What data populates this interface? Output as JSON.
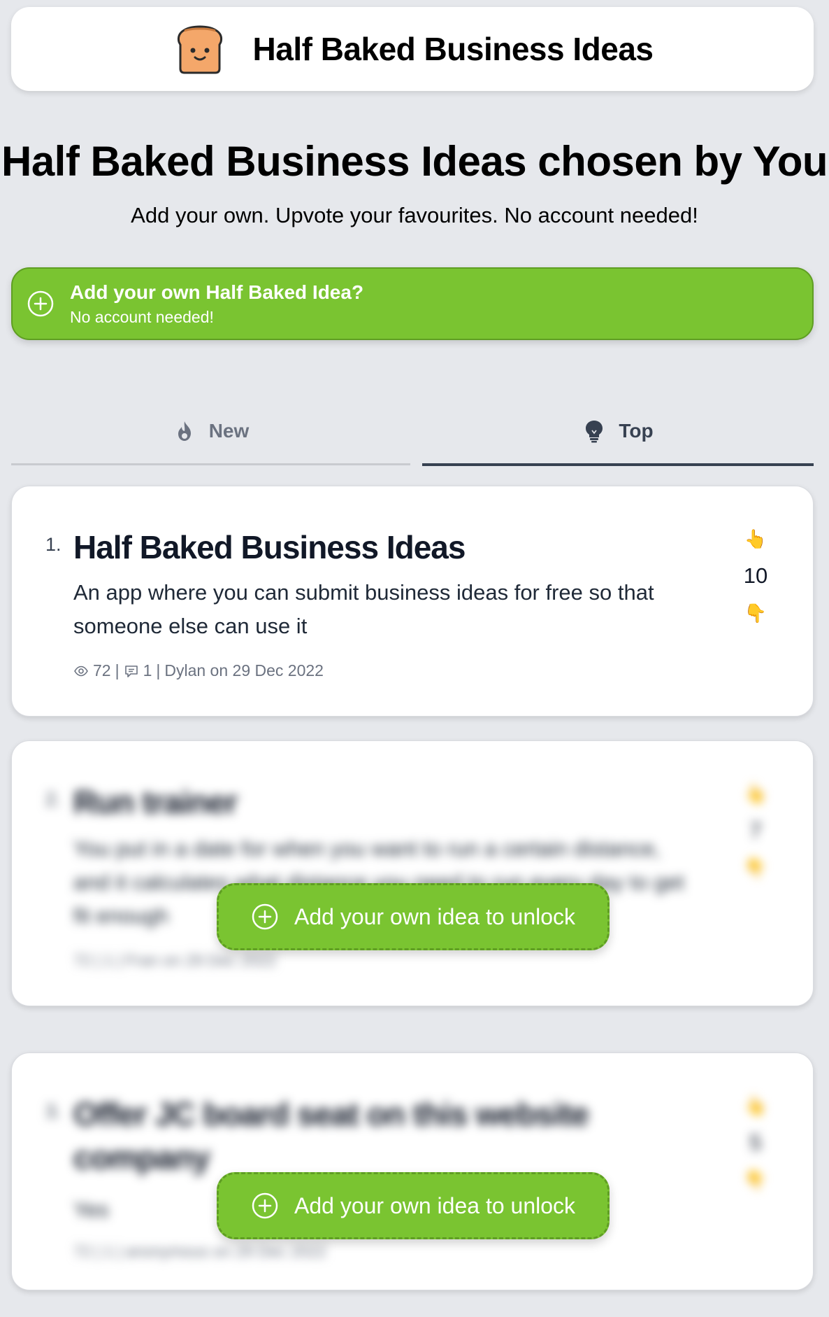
{
  "header": {
    "logo_icon": "toast-face-icon",
    "title": "Half Baked Business Ideas"
  },
  "hero": {
    "title": "Half Baked Business Ideas chosen by You",
    "subtitle": "Add your own. Upvote your favourites. No account needed!"
  },
  "cta": {
    "icon": "plus-circle-icon",
    "title": "Add your own Half Baked Idea?",
    "subtitle": "No account needed!",
    "color": "#7ac431"
  },
  "tabs": [
    {
      "label": "New",
      "icon": "flame-icon",
      "active": false
    },
    {
      "label": "Top",
      "icon": "lightbulb-icon",
      "active": true
    }
  ],
  "ideas": [
    {
      "rank": "1.",
      "title": "Half Baked Business Ideas",
      "description": "An app where you can submit business ideas for free so that someone else can use it",
      "views": "72",
      "comments": "1",
      "byline": "Dylan on 29 Dec 2022",
      "upvote": "👆",
      "votes": "10",
      "downvote": "👇",
      "locked": false
    },
    {
      "rank": "2.",
      "title": "Run trainer",
      "description": "You put in a date for when you want to run a certain distance, and it calculates what distance you need to run every day to get fit enough",
      "views": "72",
      "comments": "1",
      "byline": "Fran on 29 Dec 2022",
      "upvote": "👆",
      "votes": "7",
      "downvote": "👇",
      "locked": true
    },
    {
      "rank": "3.",
      "title": "Offer JC board seat on this website company",
      "description": "Yes",
      "views": "72",
      "comments": "1",
      "byline": "anonymous on 29 Dec 2022",
      "upvote": "👆",
      "votes": "5",
      "downvote": "👇",
      "locked": true
    }
  ],
  "unlock": {
    "label": "Add your own idea to unlock",
    "icon": "plus-circle-icon"
  }
}
